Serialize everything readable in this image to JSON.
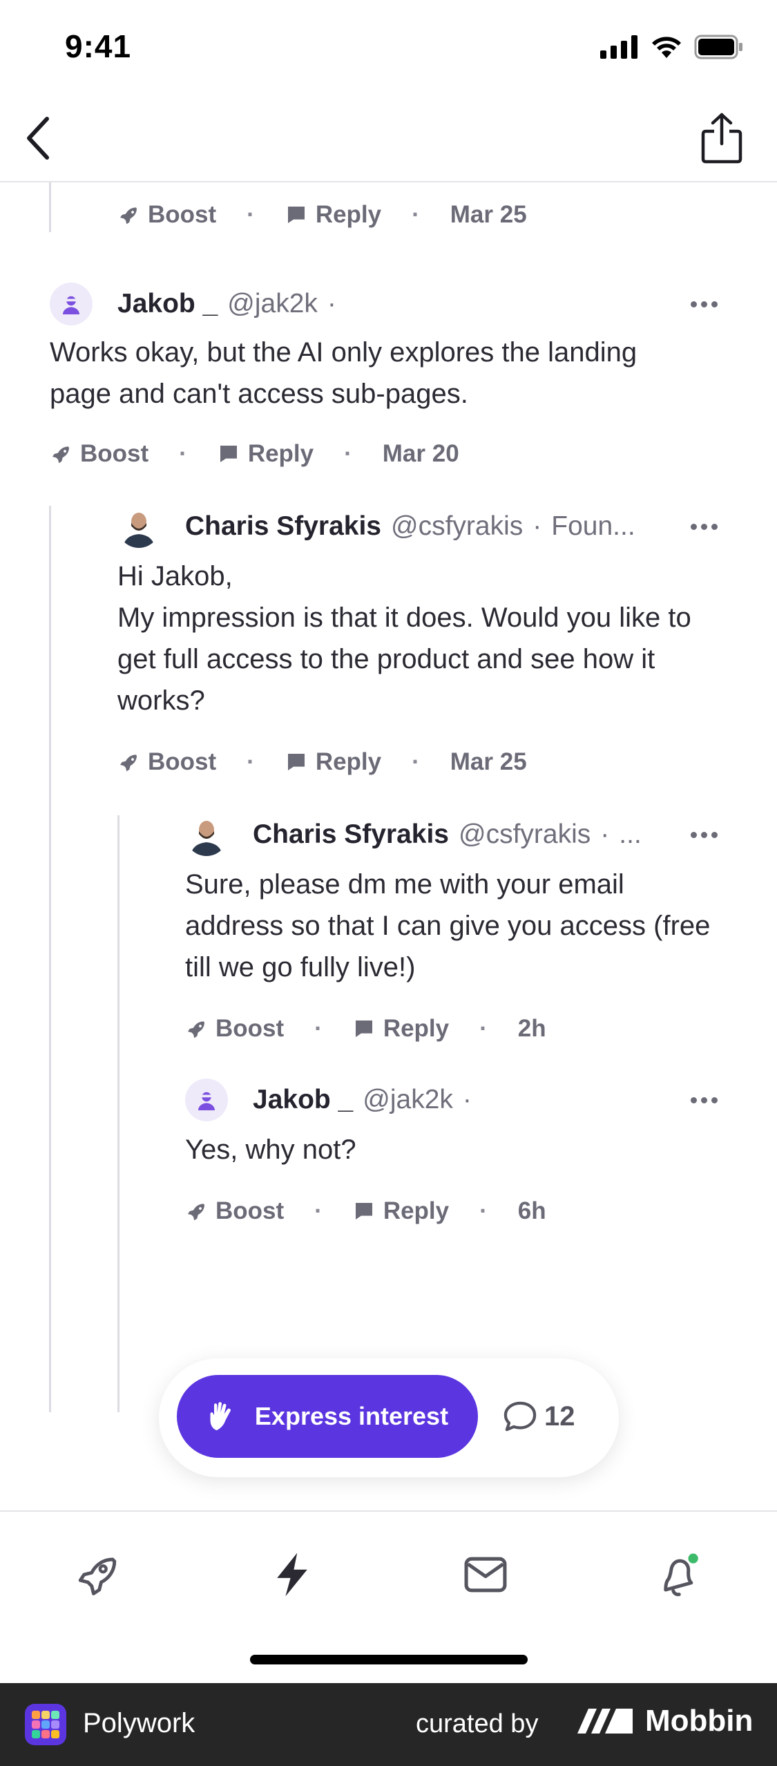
{
  "status_bar": {
    "time": "9:41"
  },
  "thread": {
    "top_actions": {
      "boost": "Boost",
      "reply": "Reply",
      "date": "Mar 25"
    },
    "comments": [
      {
        "name": "Jakob _",
        "handle": "@jak2k",
        "extra": "",
        "body": [
          "Works okay, but the AI only explores the landing",
          "page and can't access sub-pages."
        ],
        "actions": {
          "boost": "Boost",
          "reply": "Reply",
          "date": "Mar 20"
        }
      },
      {
        "name": "Charis Sfyrakis",
        "handle": "@csfyrakis",
        "extra": "Foun...",
        "body": [
          "Hi Jakob,",
          "My impression is that it does. Would you like to",
          "get full access to the product and see how it",
          "works?"
        ],
        "actions": {
          "boost": "Boost",
          "reply": "Reply",
          "date": "Mar 25"
        }
      },
      {
        "name": "Charis Sfyrakis",
        "handle": "@csfyrakis",
        "extra": "...",
        "body": [
          "Sure, please dm me with your email",
          "address so that I can give you access (free",
          "till we go fully live!)"
        ],
        "actions": {
          "boost": "Boost",
          "reply": "Reply",
          "date": "2h"
        }
      },
      {
        "name": "Jakob _",
        "handle": "@jak2k",
        "extra": "",
        "body": [
          "Yes, why not?"
        ],
        "actions": {
          "boost": "Boost",
          "reply": "Reply",
          "date": "6h"
        }
      }
    ]
  },
  "cta": {
    "button_label": "Express interest",
    "comment_count": "12"
  },
  "tab_bar": {
    "tabs": [
      {
        "icon": "rocket-icon"
      },
      {
        "icon": "lightning-icon"
      },
      {
        "icon": "inbox-icon"
      },
      {
        "icon": "bell-icon",
        "badge_color": "#3dbb6b"
      }
    ]
  },
  "footer": {
    "app_name": "Polywork",
    "curated_by": "curated by",
    "brand": "Mobbin"
  },
  "colors": {
    "accent": "#5b35e0",
    "text": "#2b2a33",
    "muted": "#6b6b78"
  }
}
